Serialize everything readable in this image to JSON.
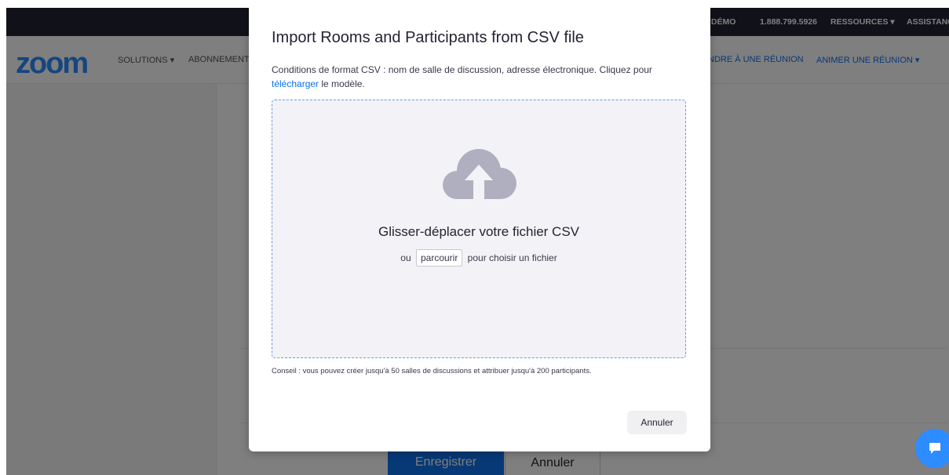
{
  "topbar": {
    "demo": "E DÉMO",
    "phone": "1.888.799.5926",
    "resources": "RESSOURCES ▾",
    "support": "ASSISTANC"
  },
  "nav": {
    "logo": "zoom",
    "solutions": "SOLUTIONS ▾",
    "plans": "ABONNEMENT",
    "join": "NDRE À UNE RÉUNION",
    "host": "ANIMER UNE RÉUNION ▾"
  },
  "background_buttons": {
    "save": "Enregistrer",
    "cancel": "Annuler"
  },
  "modal": {
    "title": "Import Rooms and Participants from CSV file",
    "desc_prefix": "Conditions de format CSV : nom de salle de discussion, adresse électronique. Cliquez pour ",
    "desc_link": "télécharger",
    "desc_suffix": " le modèle.",
    "drop_title": "Glisser-déplacer votre fichier CSV",
    "drop_or": "ou",
    "browse_label": "parcourir",
    "drop_after": "pour choisir un fichier",
    "hint": "Conseil : vous pouvez créer jusqu'à 50 salles de discussions et attribuer jusqu'à 200 participants.",
    "cancel_label": "Annuler"
  },
  "colors": {
    "brand_blue": "#2d8cff",
    "link_blue": "#0e72ed",
    "topbar_bg": "#232333",
    "cloud_icon": "#b0afbf"
  },
  "icons": {
    "upload": "cloud-upload-icon",
    "chat": "chat-icon"
  }
}
